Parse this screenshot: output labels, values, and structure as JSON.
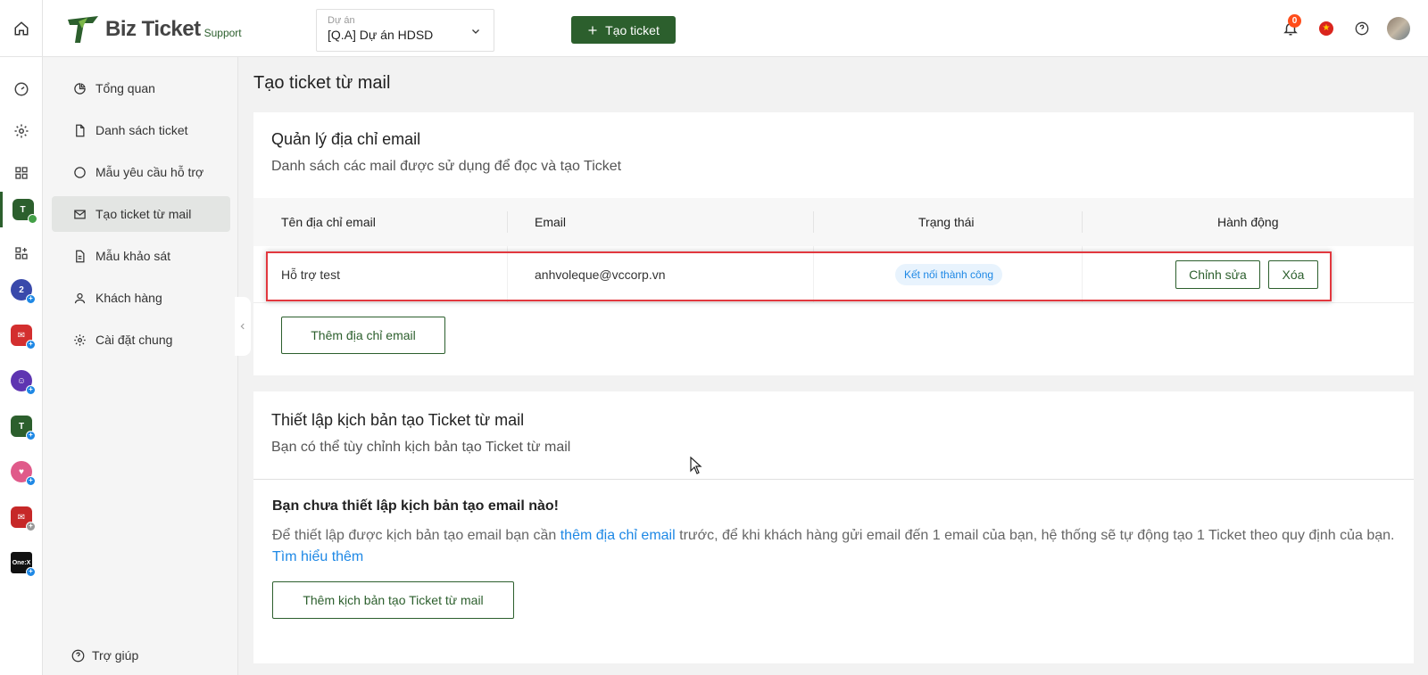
{
  "header": {
    "logo_text": "Biz Ticket",
    "logo_sub": "Support",
    "project_label": "Dự án",
    "project_value": "[Q.A] Dự án HDSD",
    "create_ticket_label": "Tạo ticket",
    "notification_count": "0"
  },
  "sidebar": {
    "items": [
      {
        "label": "Tổng quan",
        "icon": "pie-chart-icon"
      },
      {
        "label": "Danh sách ticket",
        "icon": "file-icon"
      },
      {
        "label": "Mẫu yêu cầu hỗ trợ",
        "icon": "chat-icon"
      },
      {
        "label": "Tạo ticket từ mail",
        "icon": "mail-icon"
      },
      {
        "label": "Mẫu khảo sát",
        "icon": "survey-icon"
      },
      {
        "label": "Khách hàng",
        "icon": "user-icon"
      },
      {
        "label": "Cài đặt chung",
        "icon": "gear-icon"
      }
    ],
    "active_index": 3,
    "help_label": "Trợ giúp"
  },
  "rail": {
    "badge_text": "+",
    "onex_label": "One:X"
  },
  "main": {
    "page_title": "Tạo ticket từ mail",
    "email_card": {
      "title": "Quản lý địa chỉ email",
      "subtitle": "Danh sách các mail được sử dụng để đọc và tạo Ticket",
      "columns": [
        "Tên địa chỉ email",
        "Email",
        "Trạng thái",
        "Hành động"
      ],
      "rows": [
        {
          "name": "Hỗ trợ test",
          "email": "anhvoleque@vccorp.vn",
          "status": "Kết nối thành công",
          "edit_label": "Chỉnh sửa",
          "delete_label": "Xóa"
        }
      ],
      "add_email_label": "Thêm địa chỉ email"
    },
    "script_card": {
      "title": "Thiết lập kịch bản tạo Ticket từ mail",
      "subtitle": "Bạn có thể tùy chỉnh kịch bản tạo Ticket từ mail",
      "empty_title": "Bạn chưa thiết lập kịch bản tạo email nào!",
      "empty_text_before": "Để thiết lập được kịch bản tạo email bạn cần ",
      "empty_link": "thêm địa chỉ email",
      "empty_text_after": " trước, để khi khách hàng gửi email đến 1 email của bạn, hệ thống sẽ tự động tạo 1 Ticket theo quy định của bạn.",
      "learn_more": "Tìm hiểu thêm",
      "add_script_label": "Thêm kịch bản tạo Ticket từ mail"
    }
  },
  "colors": {
    "brand_green": "#2c5f2d",
    "link_blue": "#1e88e5",
    "highlight_red": "#e2383f"
  }
}
